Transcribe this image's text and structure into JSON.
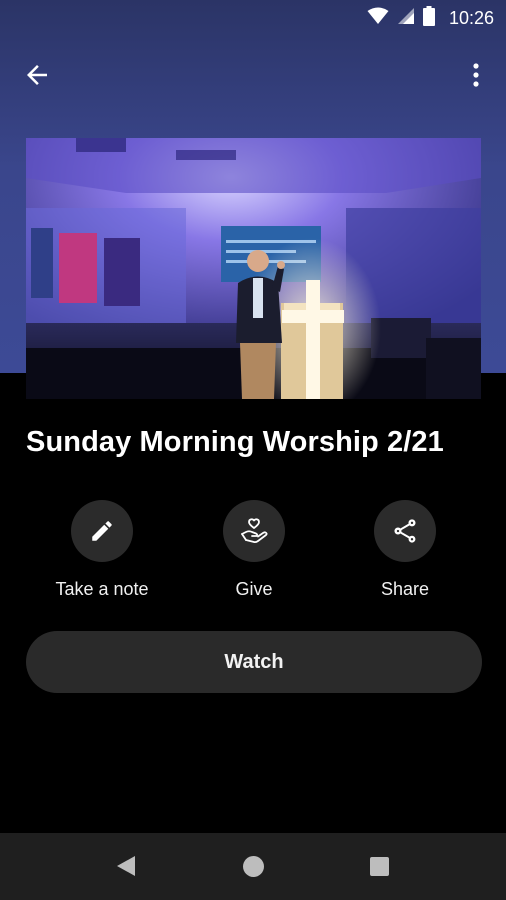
{
  "status_bar": {
    "time": "10:26",
    "icons": [
      "wifi-icon",
      "cellular-signal-icon",
      "battery-icon"
    ]
  },
  "app_bar": {
    "back_icon": "arrow-left-icon",
    "menu_icon": "more-vertical-icon"
  },
  "hero": {
    "image": "sermon-photo: pastor preaching at lit cross pulpit under purple stage lighting"
  },
  "sermon": {
    "title": "Sunday Morning Worship 2/21"
  },
  "actions": [
    {
      "label": "Take a note",
      "icon": "pencil-icon"
    },
    {
      "label": "Give",
      "icon": "hand-heart-icon"
    },
    {
      "label": "Share",
      "icon": "share-icon"
    }
  ],
  "watch": {
    "label": "Watch"
  },
  "nav_bar": {
    "icons": [
      "nav-back-icon",
      "nav-home-icon",
      "nav-recents-icon"
    ]
  },
  "colors": {
    "header_bg": "#3a468c",
    "page_bg": "#000000",
    "button_bg": "#2a2a2a",
    "nav_bg": "#1f1f1f"
  }
}
